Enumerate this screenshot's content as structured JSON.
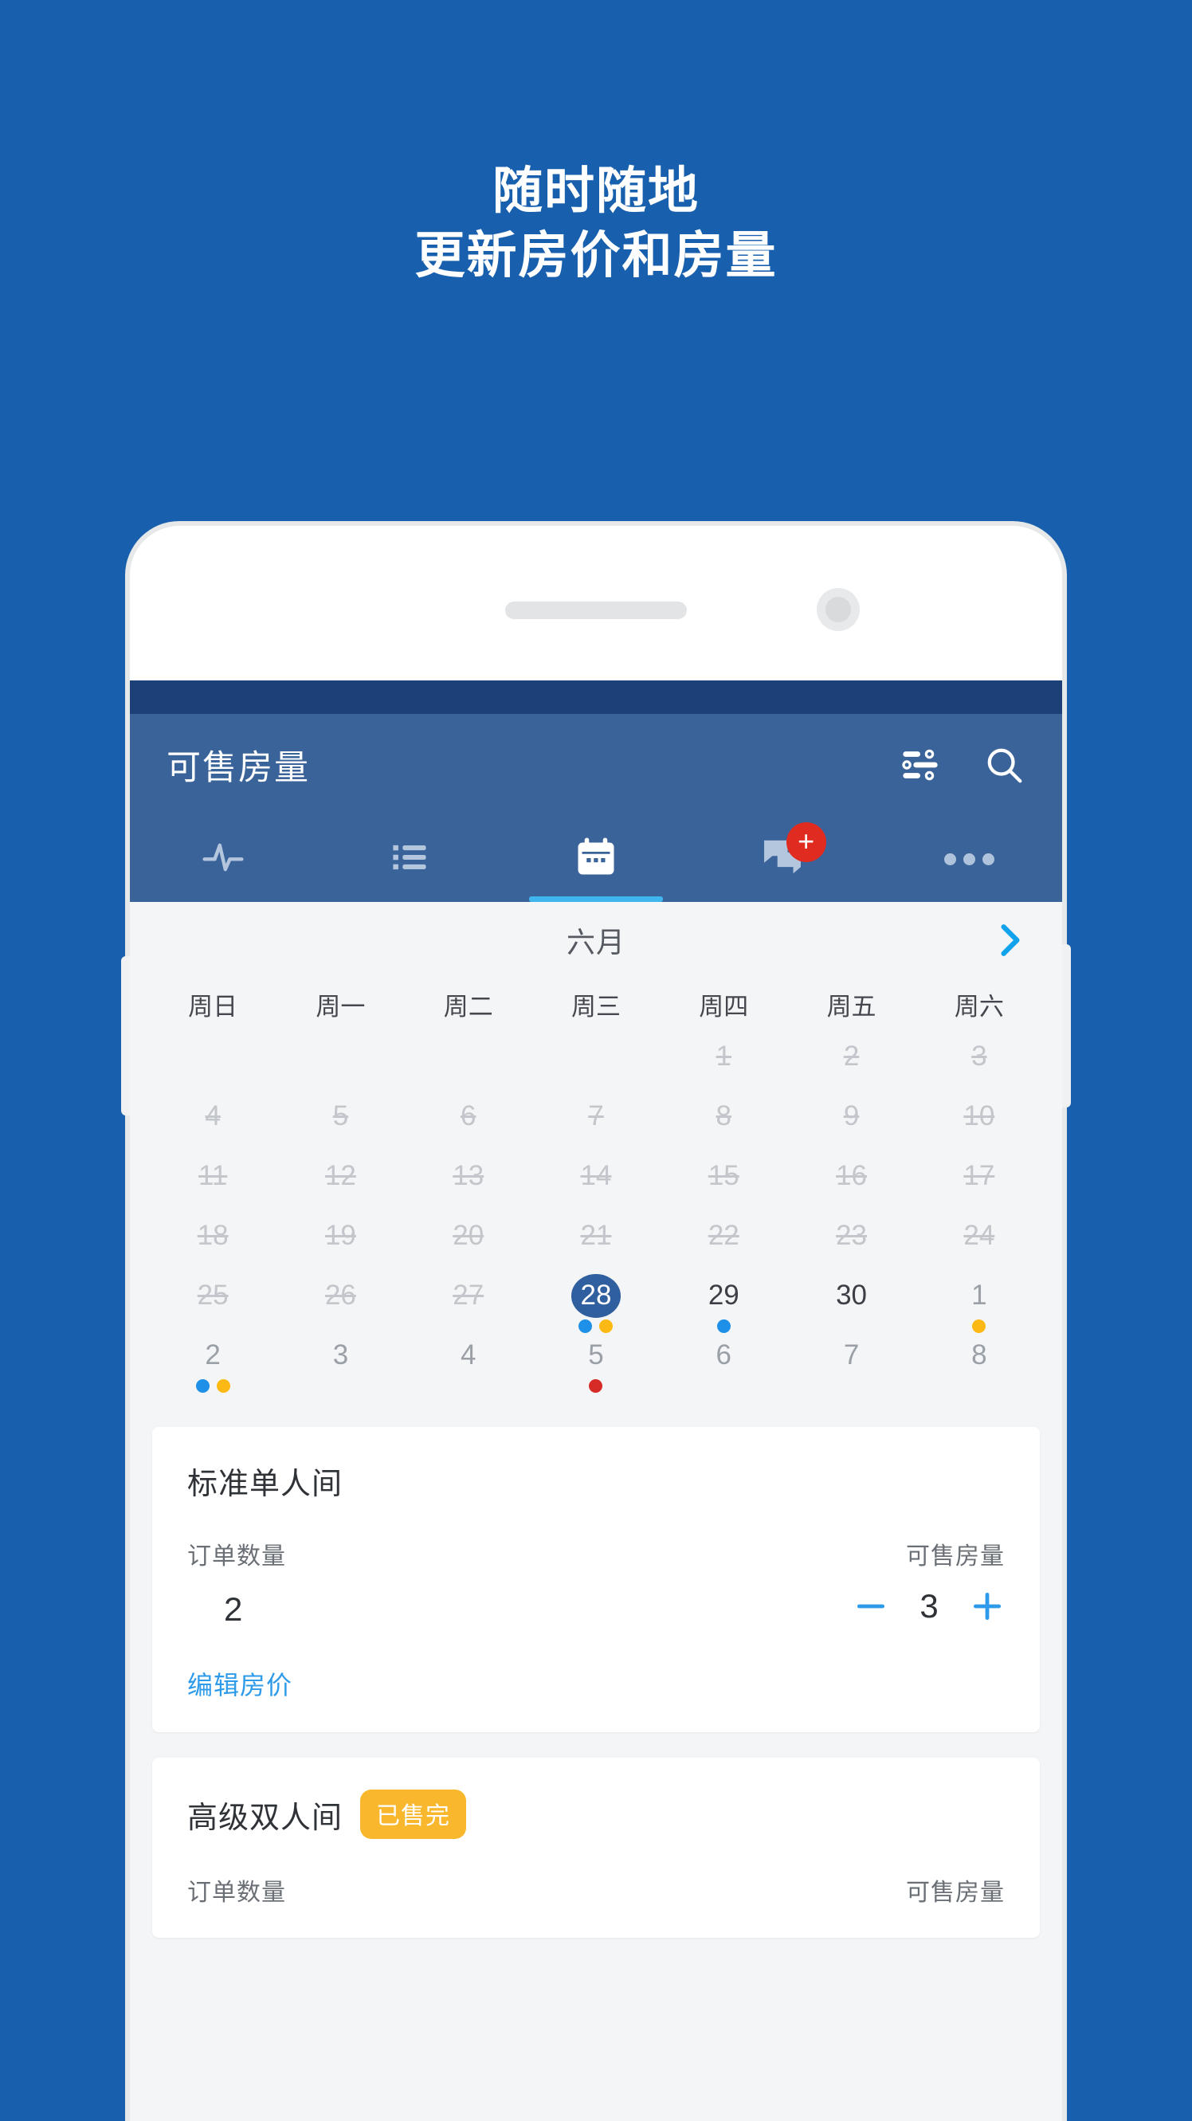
{
  "promo": {
    "line1": "随时随地",
    "line2": "更新房价和房量",
    "background_color": "#1860AE",
    "text_color": "#FFFFFF"
  },
  "phone": {
    "speaker": "speaker-grille",
    "camera": "front-camera",
    "buttons": [
      "volume-button",
      "power-button"
    ]
  },
  "app": {
    "statusbar_color": "#1C4178",
    "appbar_color": "#3A6399",
    "title": "可售房量",
    "actions": [
      {
        "name": "filter-icon",
        "label": "筛选"
      },
      {
        "name": "search-icon",
        "label": "搜索"
      }
    ],
    "tabs": [
      {
        "icon": "activity-icon",
        "label": "动态",
        "active": false,
        "badge": null
      },
      {
        "icon": "list-icon",
        "label": "订单列表",
        "active": false,
        "badge": null
      },
      {
        "icon": "calendar-icon",
        "label": "日历",
        "active": true,
        "badge": null
      },
      {
        "icon": "chat-icon",
        "label": "消息",
        "active": false,
        "badge": "+"
      },
      {
        "icon": "more-icon",
        "label": "更多",
        "active": false,
        "badge": null
      }
    ],
    "active_tab_indicator_color": "#40B6EF",
    "badge_color": "#E02B20"
  },
  "calendar": {
    "month": "六月",
    "next_label": "›",
    "weekdays": [
      "周日",
      "周一",
      "周二",
      "周三",
      "周四",
      "周五",
      "周六"
    ],
    "dot_colors": {
      "blue": "#1E90E8",
      "yellow": "#FDB913",
      "red": "#D62B26"
    },
    "selected_color": "#2F5F9E",
    "weeks": [
      [
        {
          "day": "",
          "state": "blank",
          "dots": []
        },
        {
          "day": "",
          "state": "blank",
          "dots": []
        },
        {
          "day": "",
          "state": "blank",
          "dots": []
        },
        {
          "day": "",
          "state": "blank",
          "dots": []
        },
        {
          "day": "1",
          "state": "past",
          "dots": []
        },
        {
          "day": "2",
          "state": "past",
          "dots": []
        },
        {
          "day": "3",
          "state": "past",
          "dots": []
        }
      ],
      [
        {
          "day": "4",
          "state": "past",
          "dots": []
        },
        {
          "day": "5",
          "state": "past",
          "dots": []
        },
        {
          "day": "6",
          "state": "past",
          "dots": []
        },
        {
          "day": "7",
          "state": "past",
          "dots": []
        },
        {
          "day": "8",
          "state": "past",
          "dots": []
        },
        {
          "day": "9",
          "state": "past",
          "dots": []
        },
        {
          "day": "10",
          "state": "past",
          "dots": []
        }
      ],
      [
        {
          "day": "11",
          "state": "past",
          "dots": []
        },
        {
          "day": "12",
          "state": "past",
          "dots": []
        },
        {
          "day": "13",
          "state": "past",
          "dots": []
        },
        {
          "day": "14",
          "state": "past",
          "dots": []
        },
        {
          "day": "15",
          "state": "past",
          "dots": []
        },
        {
          "day": "16",
          "state": "past",
          "dots": []
        },
        {
          "day": "17",
          "state": "past",
          "dots": []
        }
      ],
      [
        {
          "day": "18",
          "state": "past",
          "dots": []
        },
        {
          "day": "19",
          "state": "past",
          "dots": []
        },
        {
          "day": "20",
          "state": "past",
          "dots": []
        },
        {
          "day": "21",
          "state": "past",
          "dots": []
        },
        {
          "day": "22",
          "state": "past",
          "dots": []
        },
        {
          "day": "23",
          "state": "past",
          "dots": []
        },
        {
          "day": "24",
          "state": "past",
          "dots": []
        }
      ],
      [
        {
          "day": "25",
          "state": "past",
          "dots": []
        },
        {
          "day": "26",
          "state": "past",
          "dots": []
        },
        {
          "day": "27",
          "state": "past",
          "dots": []
        },
        {
          "day": "28",
          "state": "selected",
          "dots": [
            "blue",
            "yellow"
          ]
        },
        {
          "day": "29",
          "state": "normal",
          "dots": [
            "blue"
          ]
        },
        {
          "day": "30",
          "state": "normal",
          "dots": []
        },
        {
          "day": "1",
          "state": "muted",
          "dots": [
            "yellow"
          ]
        }
      ],
      [
        {
          "day": "2",
          "state": "muted",
          "dots": [
            "blue",
            "yellow"
          ]
        },
        {
          "day": "3",
          "state": "muted",
          "dots": []
        },
        {
          "day": "4",
          "state": "muted",
          "dots": []
        },
        {
          "day": "5",
          "state": "muted",
          "dots": [
            "red"
          ]
        },
        {
          "day": "6",
          "state": "muted",
          "dots": []
        },
        {
          "day": "7",
          "state": "muted",
          "dots": []
        },
        {
          "day": "8",
          "state": "muted",
          "dots": []
        }
      ]
    ]
  },
  "room_cards": [
    {
      "title": "标准单人间",
      "badge": null,
      "orders_label": "订单数量",
      "orders_value": "2",
      "available_label": "可售房量",
      "available_value": "3",
      "decrement": "−",
      "increment": "+",
      "edit_price_label": "编辑房价"
    },
    {
      "title": "高级双人间",
      "badge": "已售完",
      "badge_color": "#F8B72C",
      "orders_label": "订单数量",
      "orders_value": "",
      "available_label": "可售房量",
      "available_value": "",
      "decrement": "−",
      "increment": "+",
      "edit_price_label": ""
    }
  ]
}
